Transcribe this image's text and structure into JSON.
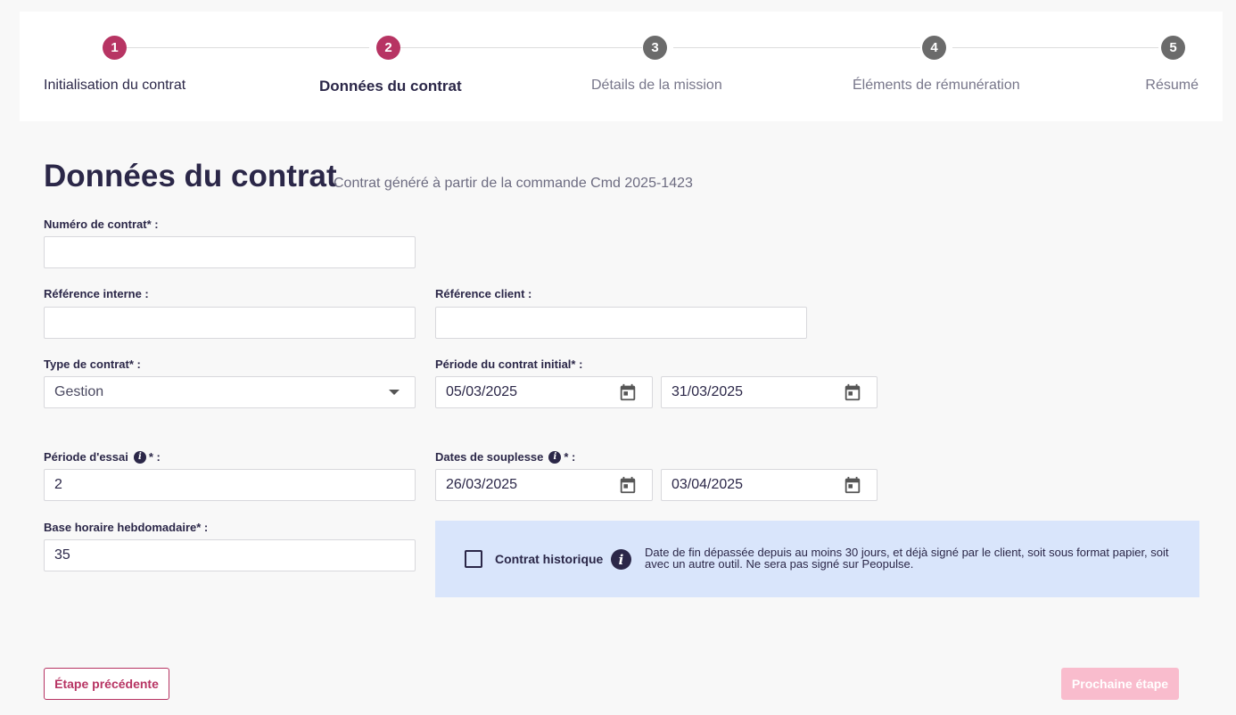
{
  "stepper": {
    "steps": [
      {
        "number": "1",
        "label": "Initialisation du contrat",
        "state": "done"
      },
      {
        "number": "2",
        "label": "Données du contrat",
        "state": "current"
      },
      {
        "number": "3",
        "label": "Détails de la mission",
        "state": "todo"
      },
      {
        "number": "4",
        "label": "Éléments de rémunération",
        "state": "todo"
      },
      {
        "number": "5",
        "label": "Résumé",
        "state": "todo"
      }
    ],
    "active_color": "#b73463",
    "inactive_color": "#6b6b6b"
  },
  "page": {
    "title": "Données du contrat",
    "subtitle": "Contrat généré à partir de la commande Cmd 2025-1423"
  },
  "form": {
    "contract_number": {
      "label": "Numéro de contrat* :",
      "value": ""
    },
    "internal_ref": {
      "label": "Référence interne :",
      "value": ""
    },
    "client_ref": {
      "label": "Référence client :",
      "value": ""
    },
    "contract_type": {
      "label": "Type de contrat* :",
      "value": "Gestion"
    },
    "initial_period": {
      "label": "Période du contrat initial* :",
      "start": "05/03/2025",
      "end": "31/03/2025"
    },
    "trial_period": {
      "label_before": "Période d'essai",
      "label_after": "* :",
      "value": "2"
    },
    "flex_dates": {
      "label_before": "Dates de souplesse",
      "label_after": "* :",
      "start": "26/03/2025",
      "end": "03/04/2025"
    },
    "weekly_hours": {
      "label": "Base horaire hebdomadaire* :",
      "value": "35"
    }
  },
  "historic": {
    "label": "Contrat historique",
    "info_text": "Date de fin dépassée depuis au moins 30 jours, et déjà signé par le client, soit sous format papier, soit avec un autre outil. Ne sera pas signé sur Peopulse.",
    "checked": false,
    "background": "#d9e5fb"
  },
  "footer": {
    "prev_label": "Étape précédente",
    "next_label": "Prochaine étape"
  },
  "icons": {
    "info": "i"
  }
}
